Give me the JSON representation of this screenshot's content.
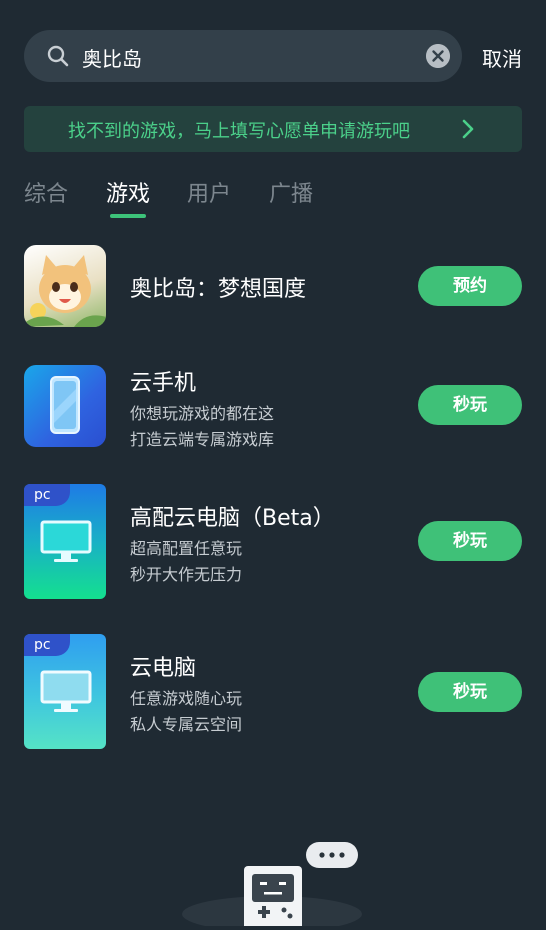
{
  "search": {
    "query": "奥比岛",
    "cancel_label": "取消"
  },
  "banner": {
    "text": "找不到的游戏，马上填写心愿单申请游玩吧"
  },
  "tabs": [
    {
      "label": "综合"
    },
    {
      "label": "游戏",
      "active": true
    },
    {
      "label": "用户"
    },
    {
      "label": "广播"
    }
  ],
  "results": [
    {
      "title": "奥比岛：梦想国度",
      "lines": [],
      "button": "预约",
      "icon": "obi-island-game-icon"
    },
    {
      "title": "云手机",
      "lines": [
        "你想玩游戏的都在这",
        "打造云端专属游戏库"
      ],
      "button": "秒玩",
      "icon": "phone-icon"
    },
    {
      "title": "高配云电脑（Beta）",
      "lines": [
        "超高配置任意玩",
        "秒开大作无压力"
      ],
      "button": "秒玩",
      "icon": "monitor-icon",
      "tag": "pc"
    },
    {
      "title": "云电脑",
      "lines": [
        "任意游戏随心玩",
        "私人专属云空间"
      ],
      "button": "秒玩",
      "icon": "monitor-icon",
      "tag": "pc"
    }
  ],
  "colors": {
    "background": "#1f2a33",
    "accent": "#3fc178",
    "banner_text": "#4bd08a"
  }
}
